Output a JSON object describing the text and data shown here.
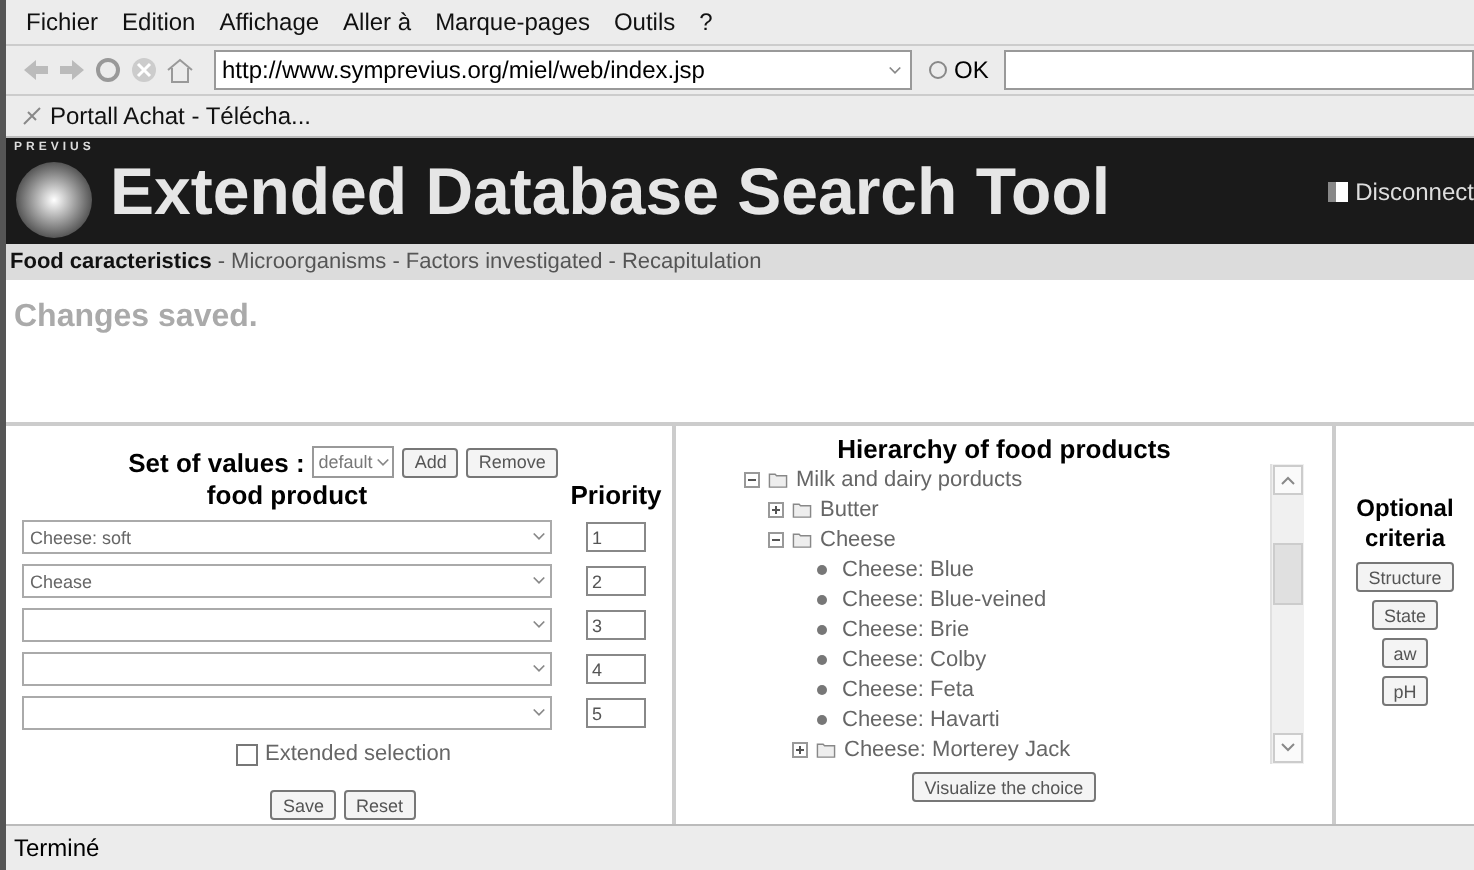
{
  "menu_bar": [
    "Fichier",
    "Edition",
    "Affichage",
    "Aller à",
    "Marque-pages",
    "Outils",
    "?"
  ],
  "address_bar": {
    "url": "http://www.symprevius.org/miel/web/index.jsp",
    "go_label": "OK"
  },
  "bookmarks": [
    "Portall Achat - Télécha..."
  ],
  "banner": {
    "logo_text": "PREVIUS",
    "title": "Extended Database Search Tool",
    "disconnect": "Disconnect"
  },
  "nav_links": [
    {
      "label": "Food caracteristics",
      "selected": true
    },
    {
      "label": "Microorganisms",
      "selected": false
    },
    {
      "label": "Factors investigated",
      "selected": false
    },
    {
      "label": "Recapitulation",
      "selected": false
    }
  ],
  "nav_separator": "-",
  "message": "Changes saved.",
  "values_panel": {
    "set_label": "Set of values :",
    "set_value": "default",
    "add": "Add",
    "remove": "Remove",
    "column_food": "food product",
    "column_priority": "Priority",
    "rows": [
      {
        "product": "Cheese: soft",
        "priority": "1"
      },
      {
        "priority": "2",
        "product": "Chease"
      },
      {
        "priority": "3"
      },
      {
        "priority": "4"
      },
      {
        "priority": "5"
      }
    ],
    "extended": {
      "label": "Extended selection",
      "checked": false
    },
    "save": "Save",
    "reset": "Reset"
  },
  "hierarchy": {
    "title": "Hierarchy of food products",
    "button": "Visualize the choice",
    "tree": [
      {
        "kind": "folder",
        "label": "Milk and dairy porducts",
        "expanded": true,
        "children": [
          {
            "kind": "folder",
            "label": "Butter",
            "expanded": false
          },
          {
            "kind": "folder",
            "label": "Cheese",
            "expanded": true,
            "children": [
              {
                "kind": "leaf",
                "label": "Cheese: Blue"
              },
              {
                "kind": "leaf",
                "label": "Cheese: Blue-veined"
              },
              {
                "kind": "leaf",
                "label": "Cheese: Brie"
              },
              {
                "kind": "leaf",
                "label": "Cheese: Colby"
              },
              {
                "kind": "leaf",
                "label": "Cheese: Feta"
              },
              {
                "kind": "leaf",
                "label": "Cheese: Havarti"
              },
              {
                "kind": "folder",
                "label": "Cheese: Morterey Jack",
                "expanded": false
              }
            ]
          }
        ]
      }
    ]
  },
  "optional": {
    "title": "Optional criteria",
    "buttons": [
      "Structure",
      "State",
      "aw",
      "pH"
    ]
  },
  "status_bar": "Terminé"
}
